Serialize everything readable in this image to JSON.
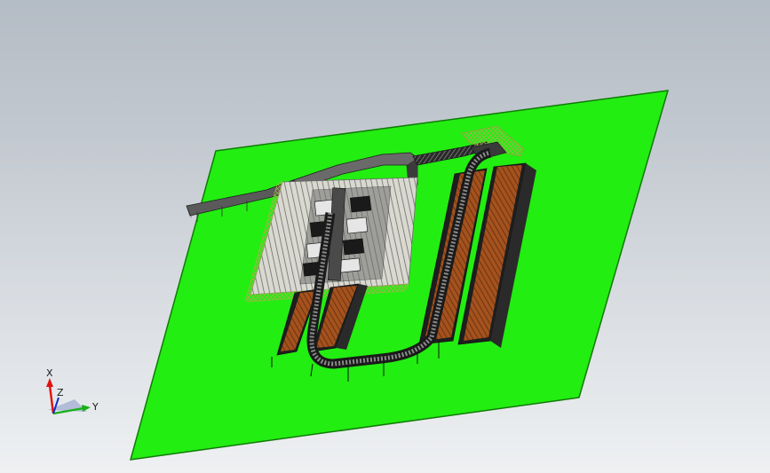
{
  "viewport": {
    "background_top": "#b4bcc5",
    "background_bottom": "#eef0f2"
  },
  "floor_plate": {
    "color": "#22ee11",
    "edge_color": "#117a08"
  },
  "conveyor": {
    "belt_color": "#3a3a3a",
    "roller_color": "#8a8a8a",
    "guard_color": "#b9c05a"
  },
  "racks": {
    "pallet_color": "#a4521e",
    "frame_color": "#222222"
  },
  "triad": {
    "x_label": "X",
    "y_label": "Y",
    "z_label": "Z",
    "x_color": "#e01010",
    "y_color": "#18b018",
    "z_color": "#1030d0"
  }
}
